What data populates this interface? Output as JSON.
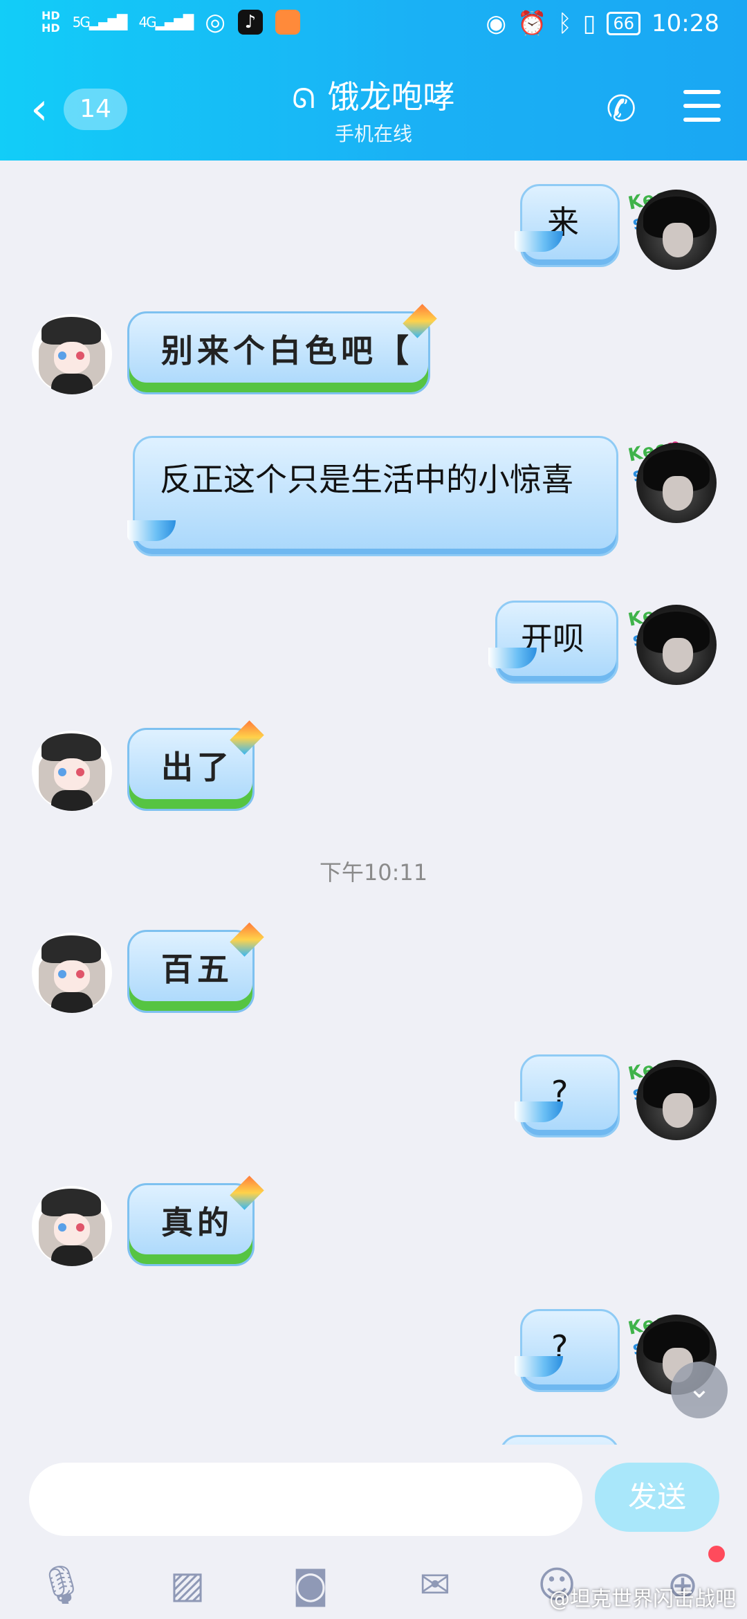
{
  "status_bar": {
    "sim1": "HD",
    "sim2": "HD",
    "net1": "5G",
    "net2": "4G",
    "battery": "66",
    "time": "10:28"
  },
  "header": {
    "back_count": "14",
    "title": "饿龙咆哮",
    "subtitle": "手机在线"
  },
  "messages": [
    {
      "side": "right",
      "text": "来"
    },
    {
      "side": "left",
      "text": "别来个白色吧【"
    },
    {
      "side": "right",
      "text": "反正这个只是生活中的小惊喜"
    },
    {
      "side": "right",
      "text": "开呗"
    },
    {
      "side": "left",
      "text": "出了"
    },
    {
      "side": "left",
      "text": "百五"
    },
    {
      "side": "right",
      "text": "?"
    },
    {
      "side": "left",
      "text": "真的"
    },
    {
      "side": "right",
      "text": "?"
    }
  ],
  "timestamp": "下午10:11",
  "keep_smile": "Keep smile",
  "composer": {
    "input_value": "",
    "send_label": "发送"
  },
  "toolbar": {
    "icons": [
      "microphone-icon",
      "image-icon",
      "camera-icon",
      "red-packet-icon",
      "emoji-icon",
      "plus-icon"
    ]
  },
  "watermark": "@坦克世界闪击战吧",
  "colors": {
    "header_start": "#12cdf8",
    "header_end": "#1aa7f3",
    "send_button": "#a9e7fa",
    "background": "#eff0f6"
  }
}
